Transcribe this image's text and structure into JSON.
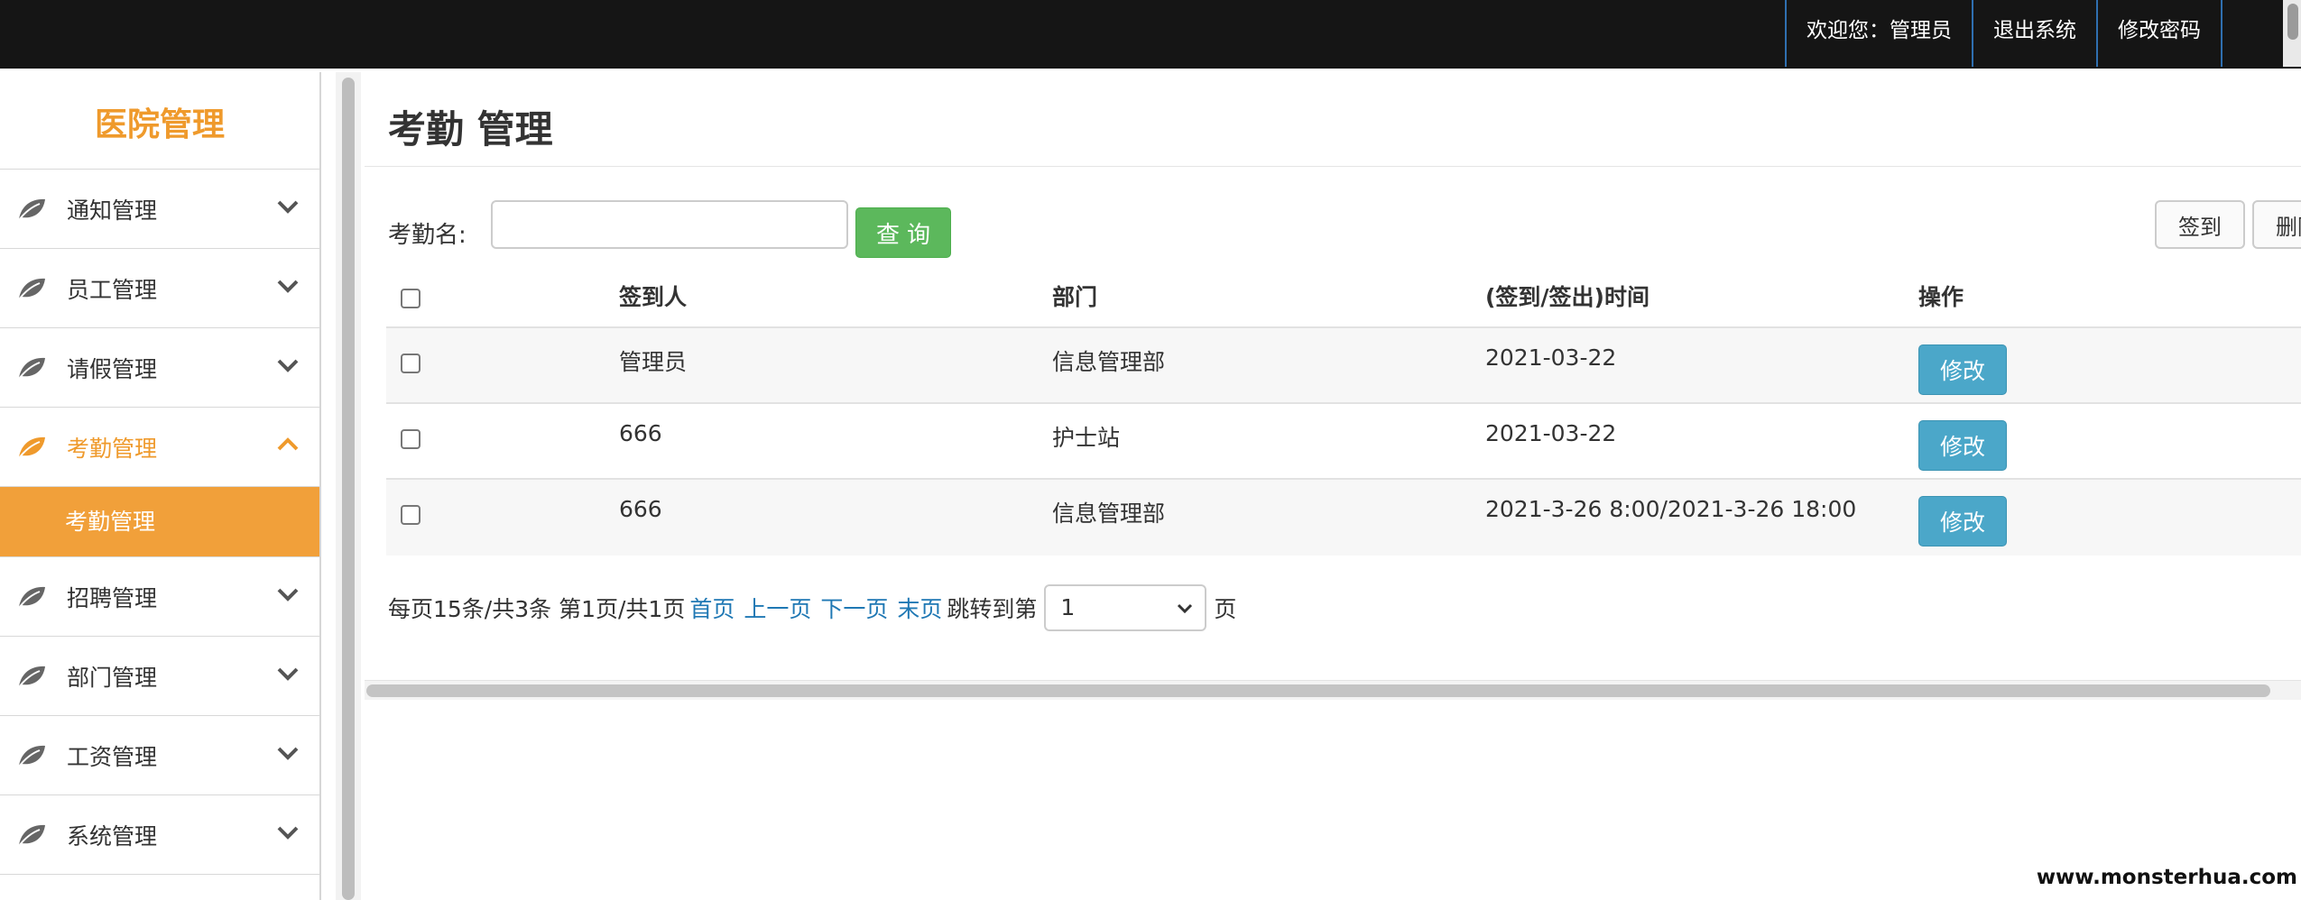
{
  "topbar": {
    "welcome": "欢迎您：管理员",
    "logout": "退出系统",
    "change_password": "修改密码"
  },
  "sidebar": {
    "brand": "医院管理",
    "items": [
      {
        "label": "通知管理",
        "icon": "leaf-icon",
        "expanded": false
      },
      {
        "label": "员工管理",
        "icon": "leaf-icon",
        "expanded": false
      },
      {
        "label": "请假管理",
        "icon": "leaf-icon",
        "expanded": false
      },
      {
        "label": "考勤管理",
        "icon": "leaf-icon",
        "expanded": true,
        "sub": "考勤管理"
      },
      {
        "label": "招聘管理",
        "icon": "leaf-icon",
        "expanded": false
      },
      {
        "label": "部门管理",
        "icon": "leaf-icon",
        "expanded": false
      },
      {
        "label": "工资管理",
        "icon": "leaf-icon",
        "expanded": false
      },
      {
        "label": "系统管理",
        "icon": "leaf-icon",
        "expanded": false
      }
    ]
  },
  "main": {
    "title": "考勤 管理",
    "search_label": "考勤名:",
    "search_value": "",
    "query_button": "查询",
    "sign_button": "签到",
    "delete_button": "删除",
    "table": {
      "headers": [
        "签到人",
        "部门",
        "(签到/签出)时间",
        "操作"
      ],
      "rows": [
        {
          "person": "管理员",
          "dept": "信息管理部",
          "time": "2021-03-22",
          "action": "修改"
        },
        {
          "person": "666",
          "dept": "护士站",
          "time": "2021-03-22",
          "action": "修改"
        },
        {
          "person": "666",
          "dept": "信息管理部",
          "time": "2021-3-26 8:00/2021-3-26 18:00",
          "action": "修改"
        }
      ]
    },
    "pager": {
      "summary": "每页15条/共3条 第1页/共1页",
      "first": "首页",
      "prev": "上一页",
      "next": "下一页",
      "last": "末页",
      "jump_label": "跳转到第",
      "page_value": "1",
      "unit": "页"
    }
  },
  "colors": {
    "accent": "#ef9a2c",
    "active_bg": "#f1a03a",
    "query": "#5cb85c",
    "edit": "#4ba7c9",
    "link": "#1f78b4"
  },
  "watermark": "www.monsterhua.com"
}
